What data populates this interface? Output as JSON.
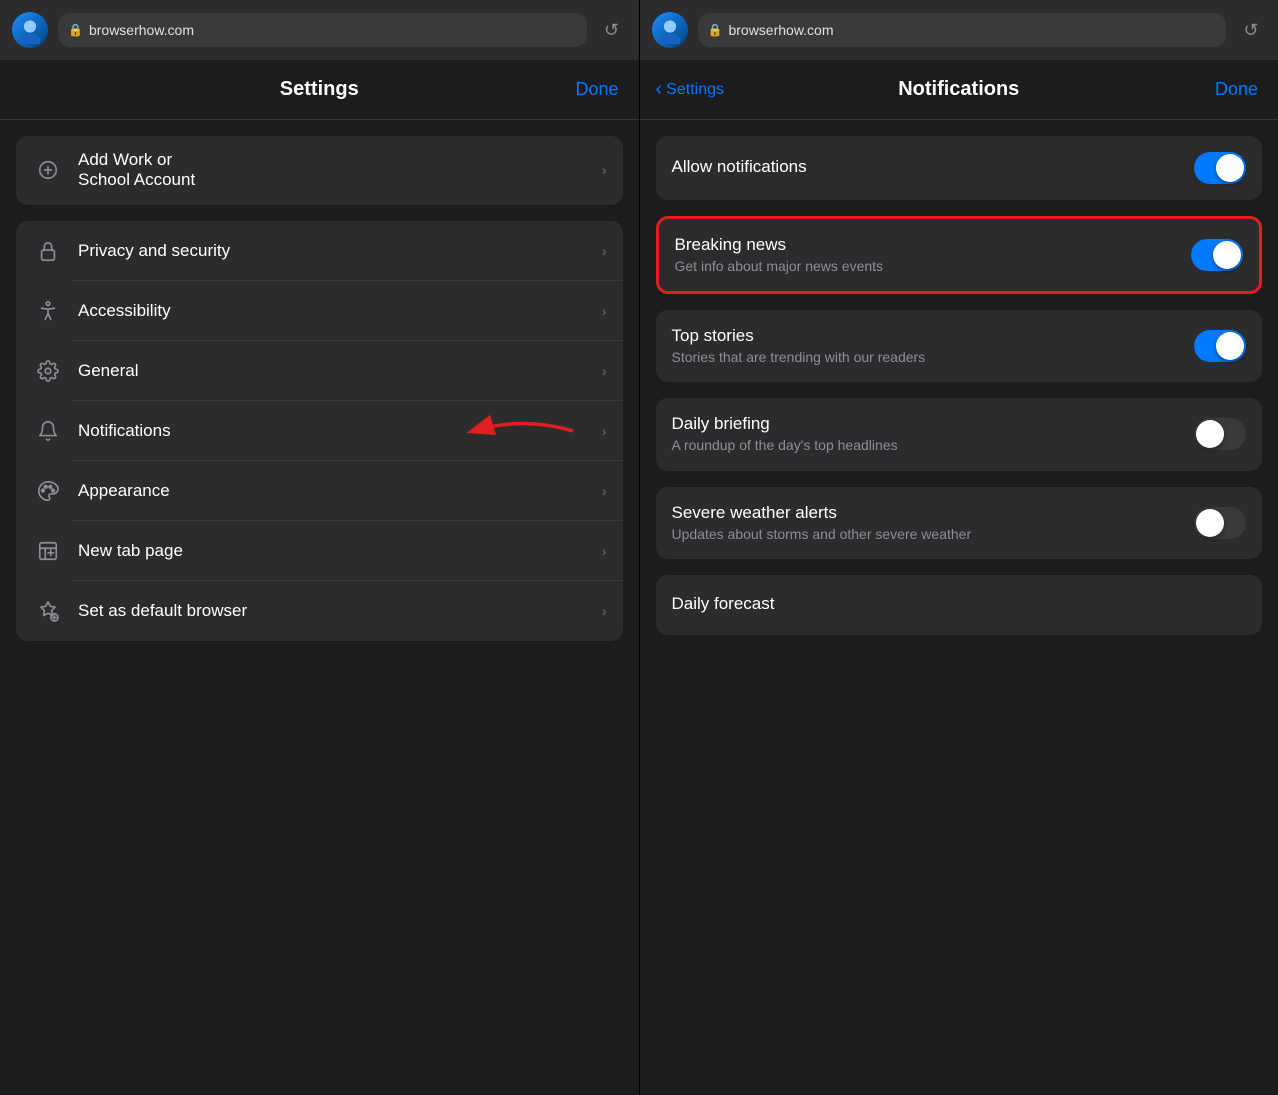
{
  "browser": {
    "url": "browserhow.com",
    "refresh_label": "↺"
  },
  "left": {
    "header": {
      "title": "Settings",
      "done_label": "Done"
    },
    "groups": [
      {
        "id": "work-group",
        "items": [
          {
            "id": "add-work-account",
            "icon": "plus-circle",
            "label": "Add Work or\nSchool Account",
            "has_chevron": true
          }
        ]
      },
      {
        "id": "main-group",
        "items": [
          {
            "id": "privacy-security",
            "icon": "lock",
            "label": "Privacy and security",
            "has_chevron": true
          },
          {
            "id": "accessibility",
            "icon": "accessibility",
            "label": "Accessibility",
            "has_chevron": true
          },
          {
            "id": "general",
            "icon": "gear",
            "label": "General",
            "has_chevron": true
          },
          {
            "id": "notifications",
            "icon": "bell",
            "label": "Notifications",
            "has_chevron": true
          },
          {
            "id": "appearance",
            "icon": "appearance",
            "label": "Appearance",
            "has_chevron": true
          },
          {
            "id": "new-tab",
            "icon": "new-tab",
            "label": "New tab page",
            "has_chevron": true
          },
          {
            "id": "default-browser",
            "icon": "star-gear",
            "label": "Set as default browser",
            "has_chevron": true
          }
        ]
      }
    ]
  },
  "right": {
    "header": {
      "back_label": "Settings",
      "title": "Notifications",
      "done_label": "Done"
    },
    "items": [
      {
        "id": "allow-notifications",
        "title": "Allow notifications",
        "subtitle": "",
        "toggle": "on",
        "highlighted": false
      },
      {
        "id": "breaking-news",
        "title": "Breaking news",
        "subtitle": "Get info about major news events",
        "toggle": "on",
        "highlighted": true
      },
      {
        "id": "top-stories",
        "title": "Top stories",
        "subtitle": "Stories that are trending with our readers",
        "toggle": "on",
        "highlighted": false
      },
      {
        "id": "daily-briefing",
        "title": "Daily briefing",
        "subtitle": "A roundup of the day's top headlines",
        "toggle": "off",
        "highlighted": false
      },
      {
        "id": "severe-weather",
        "title": "Severe weather alerts",
        "subtitle": "Updates about storms and other severe weather",
        "toggle": "off",
        "highlighted": false
      },
      {
        "id": "daily-forecast",
        "title": "Daily forecast",
        "subtitle": "",
        "toggle": "off",
        "highlighted": false
      }
    ]
  }
}
